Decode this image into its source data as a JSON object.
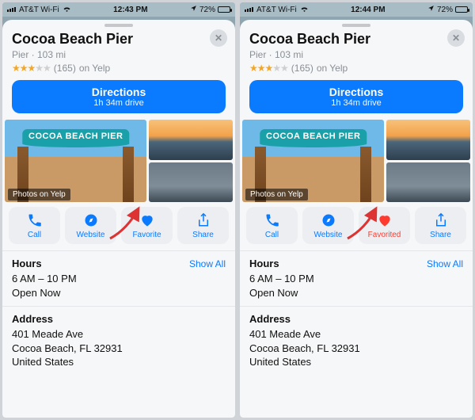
{
  "panels": [
    {
      "status": {
        "carrier": "AT&T Wi-Fi",
        "time": "12:43 PM",
        "battery": "72%"
      },
      "place": {
        "title": "Cocoa Beach Pier",
        "subtitle": "Pier · 103 mi",
        "stars": 3,
        "stars_max": 5,
        "reviews": "(165)",
        "review_source": "on Yelp"
      },
      "directions": {
        "title": "Directions",
        "subtitle": "1h 34m drive"
      },
      "photos": {
        "sign": "COCOA BEACH PIER",
        "tag": "Photos on Yelp"
      },
      "actions": {
        "call": "Call",
        "website": "Website",
        "favorite": "Favorite",
        "favorite_state": "off",
        "share": "Share"
      },
      "hours": {
        "heading": "Hours",
        "show_all": "Show All",
        "range": "6 AM – 10 PM",
        "status": "Open Now"
      },
      "address": {
        "heading": "Address",
        "line1": "401 Meade Ave",
        "line2": "Cocoa Beach, FL  32931",
        "line3": "United States"
      }
    },
    {
      "status": {
        "carrier": "AT&T Wi-Fi",
        "time": "12:44 PM",
        "battery": "72%"
      },
      "place": {
        "title": "Cocoa Beach Pier",
        "subtitle": "Pier · 103 mi",
        "stars": 3,
        "stars_max": 5,
        "reviews": "(165)",
        "review_source": "on Yelp"
      },
      "directions": {
        "title": "Directions",
        "subtitle": "1h 34m drive"
      },
      "photos": {
        "sign": "COCOA BEACH PIER",
        "tag": "Photos on Yelp"
      },
      "actions": {
        "call": "Call",
        "website": "Website",
        "favorite": "Favorited",
        "favorite_state": "on",
        "share": "Share"
      },
      "hours": {
        "heading": "Hours",
        "show_all": "Show All",
        "range": "6 AM – 10 PM",
        "status": "Open Now"
      },
      "address": {
        "heading": "Address",
        "line1": "401 Meade Ave",
        "line2": "Cocoa Beach, FL  32931",
        "line3": "United States"
      }
    }
  ],
  "colors": {
    "accent": "#0a7aff",
    "favorite_on": "#ff3b30"
  }
}
